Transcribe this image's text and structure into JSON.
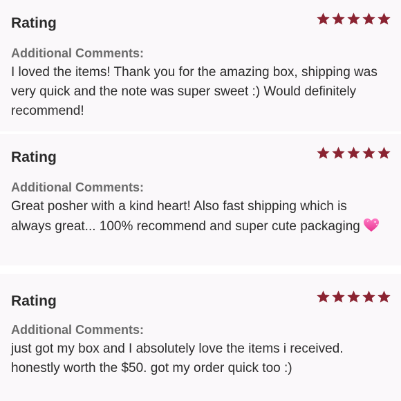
{
  "reviews": [
    {
      "rating_label": "Rating",
      "rating": 5,
      "comments_label": "Additional Comments:",
      "comment": "I loved the items! Thank you for the amazing box, shipping was very quick and the note was super sweet :) Would definitely recommend!"
    },
    {
      "rating_label": "Rating",
      "rating": 5,
      "comments_label": "Additional Comments:",
      "comment": "Great posher with a kind heart! Also fast shipping which is always great... 100% recommend and super cute packaging",
      "emoji": "sparkling-heart-icon"
    },
    {
      "rating_label": "Rating",
      "rating": 5,
      "comments_label": "Additional Comments:",
      "comment": "just got my box and I absolutely love the items i received. honestly worth the $50. got my order quick too :)"
    }
  ],
  "colors": {
    "star": "#8a2331",
    "card_background": "#faf8fa",
    "heading": "#2a2a2a",
    "label_gray": "#6b6b6b"
  }
}
